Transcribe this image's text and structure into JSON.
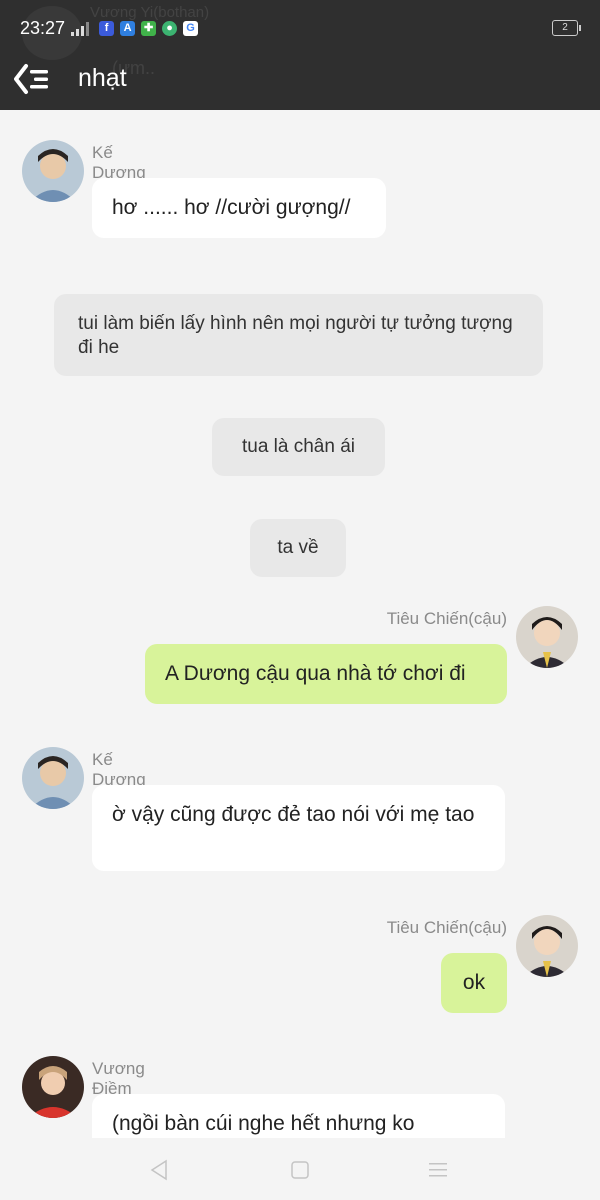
{
  "status_bar": {
    "time": "23:27",
    "battery_level": "2"
  },
  "header": {
    "title": "nhạt",
    "background_sender": "Vương Yi(bothan)",
    "background_text": "(ưm.."
  },
  "messages": [
    {
      "type": "incoming",
      "sender": "Kế Dương",
      "text": "hơ ...... hơ //cười gượng//"
    },
    {
      "type": "narration",
      "text": "tui làm biến lấy hình nên mọi người tự tưởng tượng đi he"
    },
    {
      "type": "narration",
      "text": "tua là chân ái"
    },
    {
      "type": "narration",
      "text": "ta về"
    },
    {
      "type": "outgoing",
      "sender": "Tiêu Chiến(cậu)",
      "text": "A Dương cậu qua nhà tớ chơi đi"
    },
    {
      "type": "incoming",
      "sender": "Kế Dương",
      "text": "ờ vậy cũng được đẻ tao nói với mẹ tao"
    },
    {
      "type": "outgoing",
      "sender": "Tiêu Chiến(cậu)",
      "text": "ok"
    },
    {
      "type": "incoming",
      "sender": "Vương Điềm Điềm(y)",
      "text": "(ngồi  bàn cúi nghe hết nhưng ko"
    }
  ],
  "colors": {
    "header_bg": "#2f2f2f",
    "outgoing_bubble": "#d8f39a",
    "incoming_bubble": "#ffffff",
    "narration_bubble": "#e8e8e8"
  },
  "icons": [
    "back-menu-icon",
    "signal-icon",
    "facebook-icon",
    "app-icon",
    "puzzle-icon",
    "wechat-icon",
    "google-icon",
    "battery-icon",
    "nav-back-icon",
    "nav-home-icon",
    "nav-menu-icon"
  ]
}
